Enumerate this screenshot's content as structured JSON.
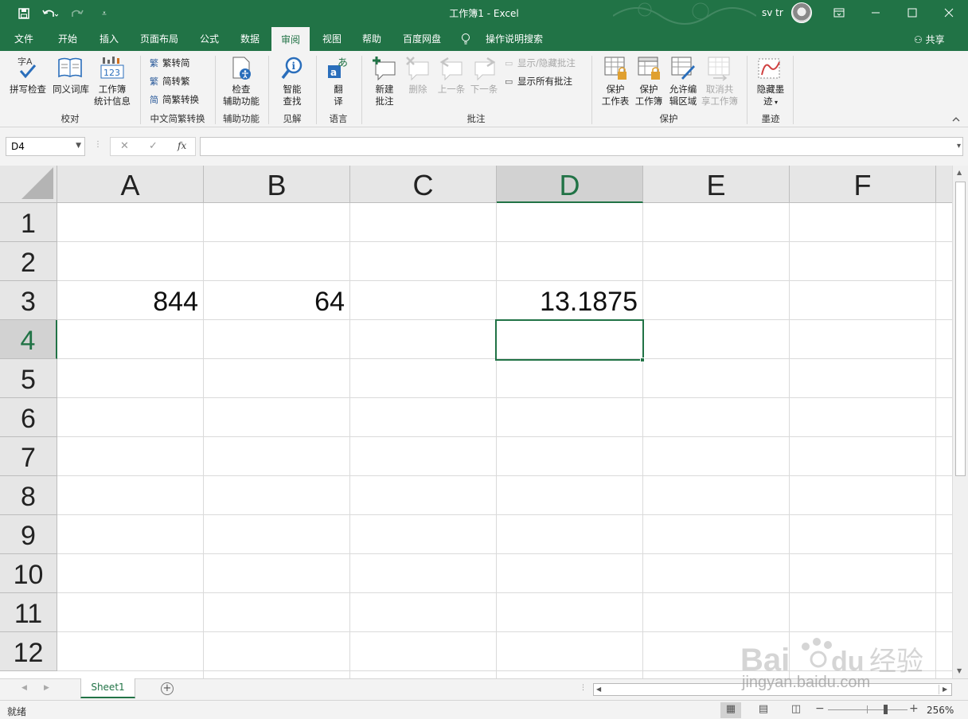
{
  "window": {
    "doc_title": "工作簿1  -  Excel",
    "user": "sv tr"
  },
  "tabs": [
    {
      "label": "文件",
      "active": false
    },
    {
      "label": "开始",
      "active": false
    },
    {
      "label": "插入",
      "active": false
    },
    {
      "label": "页面布局",
      "active": false
    },
    {
      "label": "公式",
      "active": false
    },
    {
      "label": "数据",
      "active": false
    },
    {
      "label": "审阅",
      "active": true
    },
    {
      "label": "视图",
      "active": false
    },
    {
      "label": "帮助",
      "active": false
    },
    {
      "label": "百度网盘",
      "active": false
    },
    {
      "label": "操作说明搜索",
      "active": false
    }
  ],
  "share_label": "共享",
  "ribbon": {
    "spell_check": "拼写检查",
    "thesaurus": "同义词库",
    "workbook_stats": [
      "工作簿",
      "统计信息"
    ],
    "group_proofing": "校对",
    "to_simplified": "繁转简",
    "to_traditional": "简转繁",
    "convert": "简繁转换",
    "group_chinese": "中文简繁转换",
    "check_access": [
      "检查",
      "辅助功能"
    ],
    "group_access": "辅助功能",
    "smart_lookup": [
      "智能",
      "查找"
    ],
    "group_insights": "见解",
    "translate": [
      "翻",
      "译"
    ],
    "group_language": "语言",
    "new_comment": [
      "新建",
      "批注"
    ],
    "delete": "删除",
    "previous": "上一条",
    "next": "下一条",
    "show_hide_comment": "显示/隐藏批注",
    "show_all_comments": "显示所有批注",
    "group_comments": "批注",
    "protect_sheet": [
      "保护",
      "工作表"
    ],
    "protect_workbook": [
      "保护",
      "工作簿"
    ],
    "allow_edit": [
      "允许编",
      "辑区域"
    ],
    "unshare": [
      "取消共",
      "享工作簿"
    ],
    "group_protect": "保护",
    "hide_ink": [
      "隐藏墨",
      "迹"
    ],
    "group_ink": "墨迹"
  },
  "formula_bar": {
    "name_box": "D4",
    "fx_label": "fx",
    "formula": ""
  },
  "columns": [
    "A",
    "B",
    "C",
    "D",
    "E",
    "F"
  ],
  "rows": [
    "1",
    "2",
    "3",
    "4",
    "5",
    "6",
    "7",
    "8",
    "9",
    "10",
    "11",
    "12"
  ],
  "cells": {
    "A3": "844",
    "B3": "64",
    "D3": "13.1875"
  },
  "selected_cell": "D4",
  "sheet_tab": "Sheet1",
  "status": {
    "text": "就绪",
    "zoom": "256%"
  },
  "watermark": "jingyan.baidu.com",
  "colors": {
    "accent": "#217346",
    "ribbon_bg": "#f3f3f3",
    "header_bg": "#e6e6e6"
  }
}
